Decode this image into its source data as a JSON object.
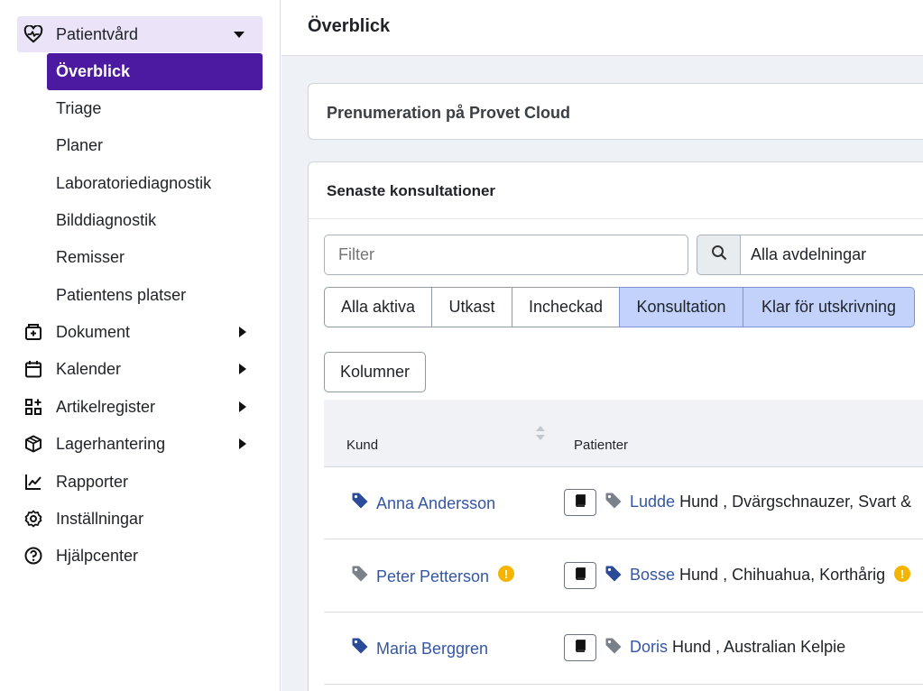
{
  "sidebar": {
    "group": {
      "label": "Patientvård",
      "icon": "heart-pulse-icon"
    },
    "sub_items": [
      {
        "label": "Överblick",
        "active": true
      },
      {
        "label": "Triage"
      },
      {
        "label": "Planer"
      },
      {
        "label": "Laboratoriediagnostik"
      },
      {
        "label": "Bilddiagnostik"
      },
      {
        "label": "Remisser"
      },
      {
        "label": "Patientens platser"
      }
    ],
    "items": [
      {
        "label": "Dokument",
        "icon": "document-add-icon",
        "has_arrow": true
      },
      {
        "label": "Kalender",
        "icon": "calendar-icon",
        "has_arrow": true
      },
      {
        "label": "Artikelregister",
        "icon": "grid-plus-icon",
        "has_arrow": true
      },
      {
        "label": "Lagerhantering",
        "icon": "box-icon",
        "has_arrow": true
      },
      {
        "label": "Rapporter",
        "icon": "chart-line-icon",
        "has_arrow": false
      },
      {
        "label": "Inställningar",
        "icon": "gear-icon",
        "has_arrow": false
      },
      {
        "label": "Hjälpcenter",
        "icon": "help-circle-icon",
        "has_arrow": false
      }
    ]
  },
  "header": {
    "title": "Överblick"
  },
  "subscription_card": {
    "title": "Prenumeration på Provet Cloud"
  },
  "consultations": {
    "title": "Senaste konsultationer",
    "filter_placeholder": "Filter",
    "department_value": "Alla avdelningar",
    "status_tabs": [
      {
        "label": "Alla aktiva",
        "selected": false
      },
      {
        "label": "Utkast",
        "selected": false
      },
      {
        "label": "Incheckad",
        "selected": false
      },
      {
        "label": "Konsultation",
        "selected": true
      },
      {
        "label": "Klar för utskrivning",
        "selected": true
      }
    ],
    "columns_button": "Kolumner",
    "headers": {
      "customer": "Kund",
      "patients": "Patienter"
    },
    "rows": [
      {
        "customer": "Anna Andersson",
        "customer_tag_color": "#2b4a9a",
        "customer_warning": false,
        "patient_name": "Ludde",
        "patient_detail": " Hund , Dvärgschnauzer, Svart &",
        "patient_tag_color": "#7a8088",
        "patient_warning": false
      },
      {
        "customer": "Peter Petterson",
        "customer_tag_color": "#7a8088",
        "customer_warning": true,
        "patient_name": "Bosse",
        "patient_detail": " Hund , Chihuahua, Korthårig",
        "patient_tag_color": "#2b4a9a",
        "patient_warning": true
      },
      {
        "customer": "Maria Berggren",
        "customer_tag_color": "#2b4a9a",
        "customer_warning": false,
        "patient_name": "Doris",
        "patient_detail": " Hund , Australian Kelpie",
        "patient_tag_color": "#7a8088",
        "patient_warning": false
      }
    ],
    "warning_glyph": "!"
  },
  "colors": {
    "brand_active": "#4b1aa0",
    "group_bg": "#ebe3f7",
    "link": "#3456a4",
    "selected_tab": "#c2d2fb",
    "warning": "#f4b400"
  }
}
